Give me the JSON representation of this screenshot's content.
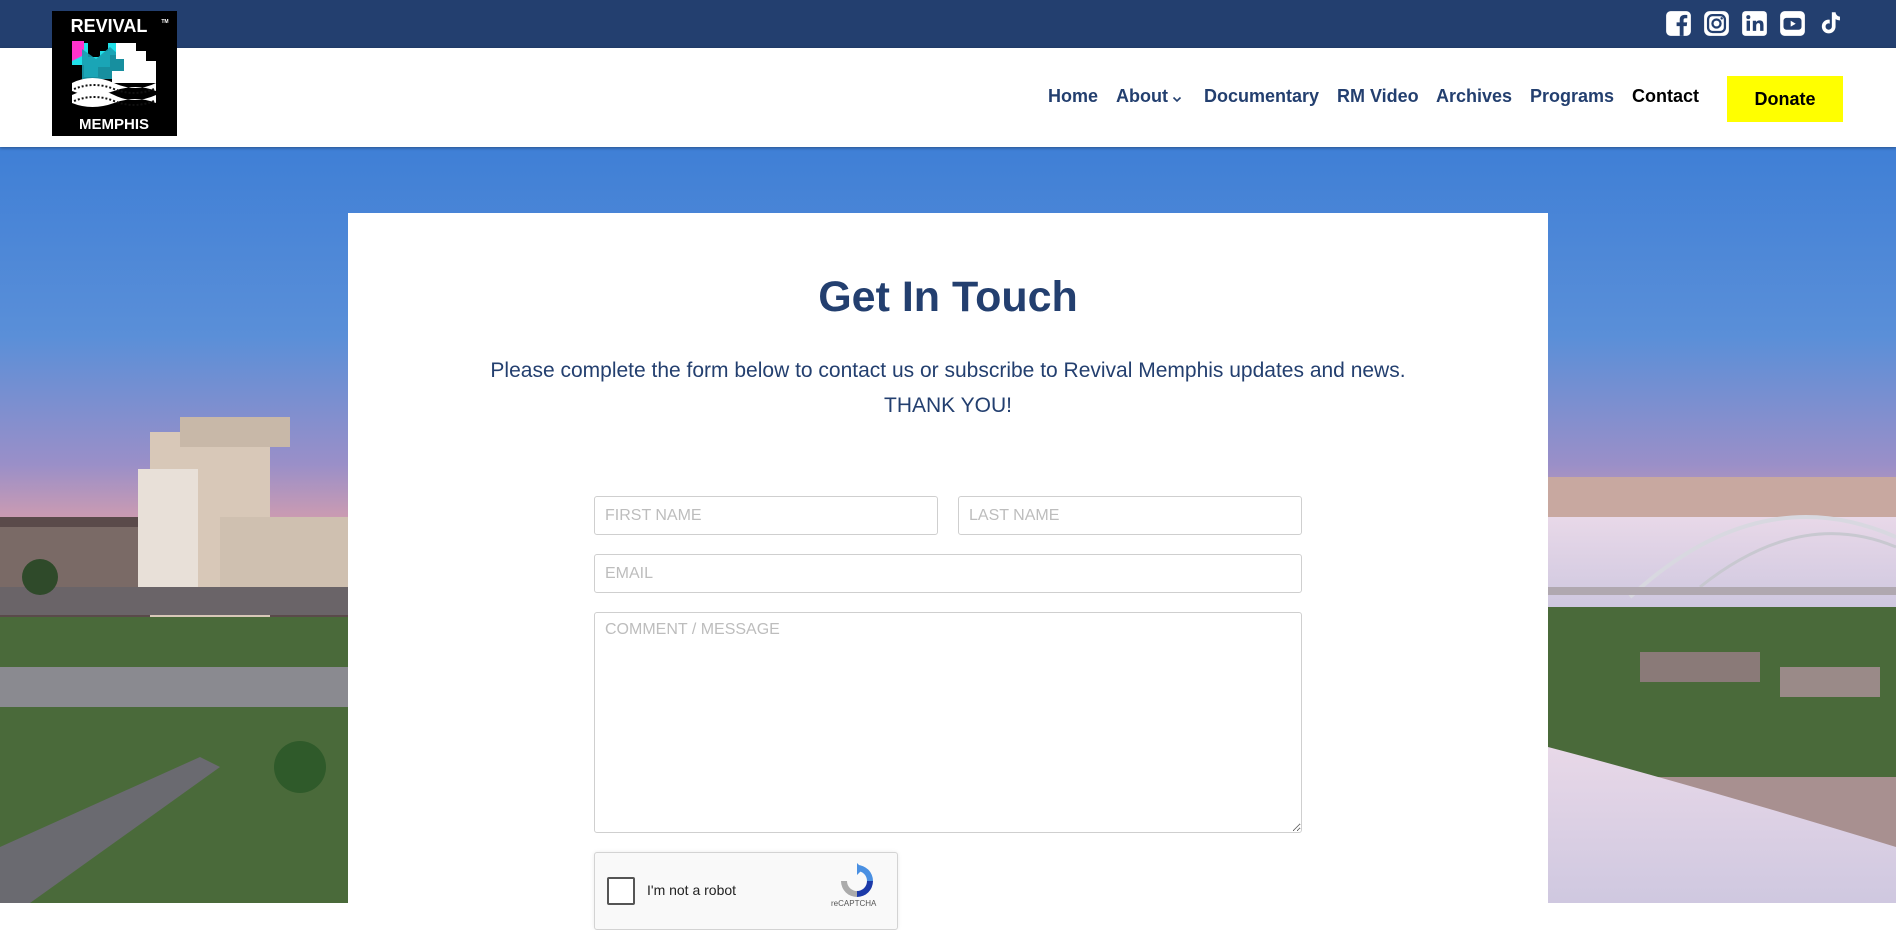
{
  "header": {
    "logo": {
      "line1": "REVIVAL",
      "line2": "MEMPHIS",
      "mark": "TM"
    },
    "social_icons": [
      "facebook-icon",
      "instagram-icon",
      "linkedin-icon",
      "youtube-icon",
      "tiktok-icon"
    ],
    "nav": {
      "home": "Home",
      "about": "About",
      "documentary": "Documentary",
      "rm_video": "RM Video",
      "archives": "Archives",
      "programs": "Programs",
      "contact": "Contact",
      "donate": "Donate"
    },
    "active_item": "Contact"
  },
  "contact": {
    "title": "Get In Touch",
    "subtitle_line1": "Please complete the form below to contact us or subscribe to Revival Memphis updates and news.",
    "subtitle_line2": "THANK YOU!",
    "form": {
      "first_name_placeholder": "FIRST NAME",
      "last_name_placeholder": "LAST NAME",
      "email_placeholder": "EMAIL",
      "message_placeholder": "COMMENT / MESSAGE"
    },
    "captcha": {
      "label": "I'm not a robot",
      "brand": "reCAPTCHA"
    }
  },
  "colors": {
    "brand_navy": "#233f6f",
    "donate_yellow": "#ffff00",
    "header_bg": "#ffffff",
    "active_nav": "#000000"
  }
}
